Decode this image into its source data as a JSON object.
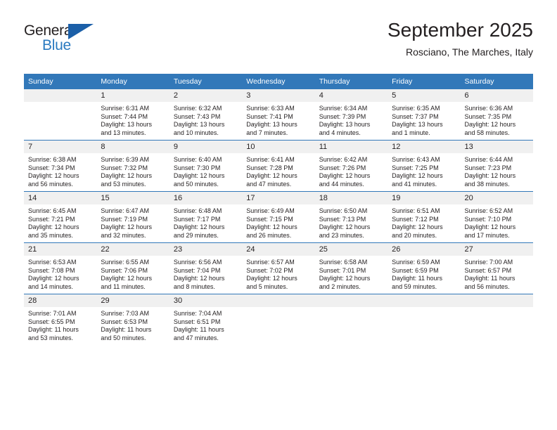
{
  "brand": {
    "line1": "General",
    "line2": "Blue",
    "triangle_color": "#1b5fa8",
    "blue_color": "#2a7ac0"
  },
  "header": {
    "title": "September 2025",
    "subtitle": "Rosciano, The Marches, Italy"
  },
  "theme": {
    "header_bg": "#3278b9",
    "daynum_bg": "#f0f0f0",
    "text": "#231f20"
  },
  "weekdays": [
    "Sunday",
    "Monday",
    "Tuesday",
    "Wednesday",
    "Thursday",
    "Friday",
    "Saturday"
  ],
  "weeks": [
    [
      {
        "day": "",
        "sunrise": "",
        "sunset": "",
        "daylight_line1": "",
        "daylight_line2": ""
      },
      {
        "day": "1",
        "sunrise": "Sunrise: 6:31 AM",
        "sunset": "Sunset: 7:44 PM",
        "daylight_line1": "Daylight: 13 hours",
        "daylight_line2": "and 13 minutes."
      },
      {
        "day": "2",
        "sunrise": "Sunrise: 6:32 AM",
        "sunset": "Sunset: 7:43 PM",
        "daylight_line1": "Daylight: 13 hours",
        "daylight_line2": "and 10 minutes."
      },
      {
        "day": "3",
        "sunrise": "Sunrise: 6:33 AM",
        "sunset": "Sunset: 7:41 PM",
        "daylight_line1": "Daylight: 13 hours",
        "daylight_line2": "and 7 minutes."
      },
      {
        "day": "4",
        "sunrise": "Sunrise: 6:34 AM",
        "sunset": "Sunset: 7:39 PM",
        "daylight_line1": "Daylight: 13 hours",
        "daylight_line2": "and 4 minutes."
      },
      {
        "day": "5",
        "sunrise": "Sunrise: 6:35 AM",
        "sunset": "Sunset: 7:37 PM",
        "daylight_line1": "Daylight: 13 hours",
        "daylight_line2": "and 1 minute."
      },
      {
        "day": "6",
        "sunrise": "Sunrise: 6:36 AM",
        "sunset": "Sunset: 7:35 PM",
        "daylight_line1": "Daylight: 12 hours",
        "daylight_line2": "and 58 minutes."
      }
    ],
    [
      {
        "day": "7",
        "sunrise": "Sunrise: 6:38 AM",
        "sunset": "Sunset: 7:34 PM",
        "daylight_line1": "Daylight: 12 hours",
        "daylight_line2": "and 56 minutes."
      },
      {
        "day": "8",
        "sunrise": "Sunrise: 6:39 AM",
        "sunset": "Sunset: 7:32 PM",
        "daylight_line1": "Daylight: 12 hours",
        "daylight_line2": "and 53 minutes."
      },
      {
        "day": "9",
        "sunrise": "Sunrise: 6:40 AM",
        "sunset": "Sunset: 7:30 PM",
        "daylight_line1": "Daylight: 12 hours",
        "daylight_line2": "and 50 minutes."
      },
      {
        "day": "10",
        "sunrise": "Sunrise: 6:41 AM",
        "sunset": "Sunset: 7:28 PM",
        "daylight_line1": "Daylight: 12 hours",
        "daylight_line2": "and 47 minutes."
      },
      {
        "day": "11",
        "sunrise": "Sunrise: 6:42 AM",
        "sunset": "Sunset: 7:26 PM",
        "daylight_line1": "Daylight: 12 hours",
        "daylight_line2": "and 44 minutes."
      },
      {
        "day": "12",
        "sunrise": "Sunrise: 6:43 AM",
        "sunset": "Sunset: 7:25 PM",
        "daylight_line1": "Daylight: 12 hours",
        "daylight_line2": "and 41 minutes."
      },
      {
        "day": "13",
        "sunrise": "Sunrise: 6:44 AM",
        "sunset": "Sunset: 7:23 PM",
        "daylight_line1": "Daylight: 12 hours",
        "daylight_line2": "and 38 minutes."
      }
    ],
    [
      {
        "day": "14",
        "sunrise": "Sunrise: 6:45 AM",
        "sunset": "Sunset: 7:21 PM",
        "daylight_line1": "Daylight: 12 hours",
        "daylight_line2": "and 35 minutes."
      },
      {
        "day": "15",
        "sunrise": "Sunrise: 6:47 AM",
        "sunset": "Sunset: 7:19 PM",
        "daylight_line1": "Daylight: 12 hours",
        "daylight_line2": "and 32 minutes."
      },
      {
        "day": "16",
        "sunrise": "Sunrise: 6:48 AM",
        "sunset": "Sunset: 7:17 PM",
        "daylight_line1": "Daylight: 12 hours",
        "daylight_line2": "and 29 minutes."
      },
      {
        "day": "17",
        "sunrise": "Sunrise: 6:49 AM",
        "sunset": "Sunset: 7:15 PM",
        "daylight_line1": "Daylight: 12 hours",
        "daylight_line2": "and 26 minutes."
      },
      {
        "day": "18",
        "sunrise": "Sunrise: 6:50 AM",
        "sunset": "Sunset: 7:13 PM",
        "daylight_line1": "Daylight: 12 hours",
        "daylight_line2": "and 23 minutes."
      },
      {
        "day": "19",
        "sunrise": "Sunrise: 6:51 AM",
        "sunset": "Sunset: 7:12 PM",
        "daylight_line1": "Daylight: 12 hours",
        "daylight_line2": "and 20 minutes."
      },
      {
        "day": "20",
        "sunrise": "Sunrise: 6:52 AM",
        "sunset": "Sunset: 7:10 PM",
        "daylight_line1": "Daylight: 12 hours",
        "daylight_line2": "and 17 minutes."
      }
    ],
    [
      {
        "day": "21",
        "sunrise": "Sunrise: 6:53 AM",
        "sunset": "Sunset: 7:08 PM",
        "daylight_line1": "Daylight: 12 hours",
        "daylight_line2": "and 14 minutes."
      },
      {
        "day": "22",
        "sunrise": "Sunrise: 6:55 AM",
        "sunset": "Sunset: 7:06 PM",
        "daylight_line1": "Daylight: 12 hours",
        "daylight_line2": "and 11 minutes."
      },
      {
        "day": "23",
        "sunrise": "Sunrise: 6:56 AM",
        "sunset": "Sunset: 7:04 PM",
        "daylight_line1": "Daylight: 12 hours",
        "daylight_line2": "and 8 minutes."
      },
      {
        "day": "24",
        "sunrise": "Sunrise: 6:57 AM",
        "sunset": "Sunset: 7:02 PM",
        "daylight_line1": "Daylight: 12 hours",
        "daylight_line2": "and 5 minutes."
      },
      {
        "day": "25",
        "sunrise": "Sunrise: 6:58 AM",
        "sunset": "Sunset: 7:01 PM",
        "daylight_line1": "Daylight: 12 hours",
        "daylight_line2": "and 2 minutes."
      },
      {
        "day": "26",
        "sunrise": "Sunrise: 6:59 AM",
        "sunset": "Sunset: 6:59 PM",
        "daylight_line1": "Daylight: 11 hours",
        "daylight_line2": "and 59 minutes."
      },
      {
        "day": "27",
        "sunrise": "Sunrise: 7:00 AM",
        "sunset": "Sunset: 6:57 PM",
        "daylight_line1": "Daylight: 11 hours",
        "daylight_line2": "and 56 minutes."
      }
    ],
    [
      {
        "day": "28",
        "sunrise": "Sunrise: 7:01 AM",
        "sunset": "Sunset: 6:55 PM",
        "daylight_line1": "Daylight: 11 hours",
        "daylight_line2": "and 53 minutes."
      },
      {
        "day": "29",
        "sunrise": "Sunrise: 7:03 AM",
        "sunset": "Sunset: 6:53 PM",
        "daylight_line1": "Daylight: 11 hours",
        "daylight_line2": "and 50 minutes."
      },
      {
        "day": "30",
        "sunrise": "Sunrise: 7:04 AM",
        "sunset": "Sunset: 6:51 PM",
        "daylight_line1": "Daylight: 11 hours",
        "daylight_line2": "and 47 minutes."
      },
      {
        "day": "",
        "sunrise": "",
        "sunset": "",
        "daylight_line1": "",
        "daylight_line2": ""
      },
      {
        "day": "",
        "sunrise": "",
        "sunset": "",
        "daylight_line1": "",
        "daylight_line2": ""
      },
      {
        "day": "",
        "sunrise": "",
        "sunset": "",
        "daylight_line1": "",
        "daylight_line2": ""
      },
      {
        "day": "",
        "sunrise": "",
        "sunset": "",
        "daylight_line1": "",
        "daylight_line2": ""
      }
    ]
  ]
}
